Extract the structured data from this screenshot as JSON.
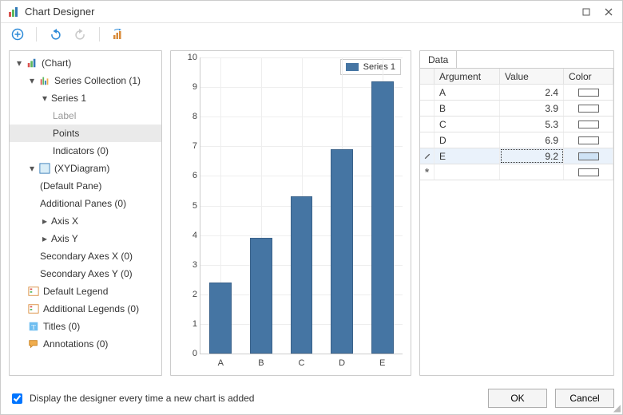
{
  "window": {
    "title": "Chart Designer"
  },
  "tree": {
    "nodes": [
      {
        "label": "(Chart)"
      },
      {
        "label": "Series Collection (1)"
      },
      {
        "label": "Series 1"
      },
      {
        "label": "Label"
      },
      {
        "label": "Points"
      },
      {
        "label": "Indicators (0)"
      },
      {
        "label": "(XYDiagram)"
      },
      {
        "label": "(Default Pane)"
      },
      {
        "label": "Additional Panes (0)"
      },
      {
        "label": "Axis X"
      },
      {
        "label": "Axis Y"
      },
      {
        "label": "Secondary Axes X (0)"
      },
      {
        "label": "Secondary Axes Y (0)"
      },
      {
        "label": "Default Legend"
      },
      {
        "label": "Additional Legends (0)"
      },
      {
        "label": "Titles (0)"
      },
      {
        "label": "Annotations (0)"
      }
    ]
  },
  "chart_data": {
    "type": "bar",
    "categories": [
      "A",
      "B",
      "C",
      "D",
      "E"
    ],
    "values": [
      2.4,
      3.9,
      5.3,
      6.9,
      9.2
    ],
    "series_name": "Series 1",
    "ylim": [
      0,
      10
    ],
    "yticks": [
      0,
      1,
      2,
      3,
      4,
      5,
      6,
      7,
      8,
      9,
      10
    ],
    "title": "",
    "xlabel": "",
    "ylabel": ""
  },
  "grid": {
    "tab": "Data",
    "headers": {
      "arg": "Argument",
      "val": "Value",
      "color": "Color"
    },
    "rows": [
      {
        "arg": "A",
        "val": "2.4"
      },
      {
        "arg": "B",
        "val": "3.9"
      },
      {
        "arg": "C",
        "val": "5.3"
      },
      {
        "arg": "D",
        "val": "6.9"
      },
      {
        "arg": "E",
        "val": "9.2"
      }
    ],
    "active_index": 4
  },
  "footer": {
    "checkbox_label": "Display the designer every time a new chart is added",
    "checkbox_checked": true,
    "ok": "OK",
    "cancel": "Cancel"
  },
  "colors": {
    "bar": "#4575a3"
  }
}
